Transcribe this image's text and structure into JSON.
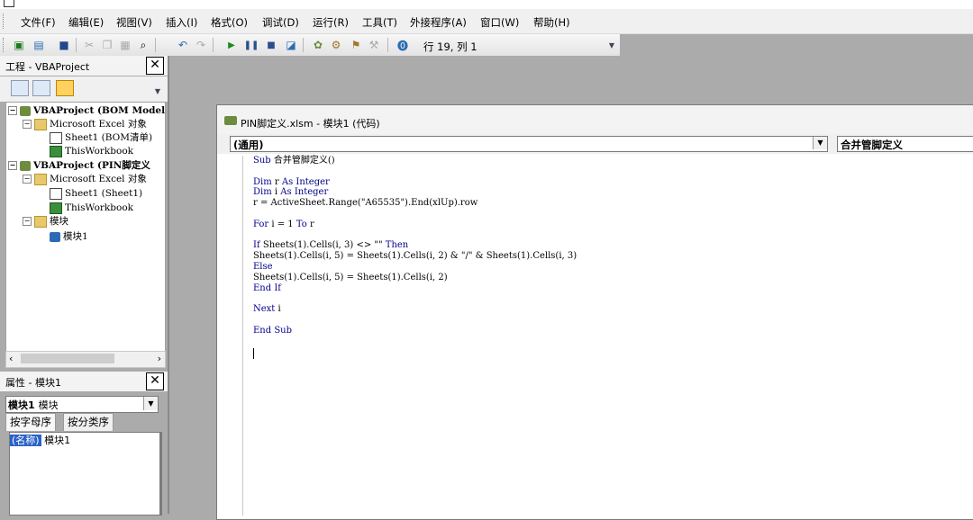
{
  "menubar": {
    "items": [
      "文件(F)",
      "编辑(E)",
      "视图(V)",
      "插入(I)",
      "格式(O)",
      "调试(D)",
      "运行(R)",
      "工具(T)",
      "外接程序(A)",
      "窗口(W)",
      "帮助(H)"
    ]
  },
  "toolbar": {
    "position_label": "行 19, 列 1"
  },
  "project_explorer": {
    "title": "工程 - VBAProject",
    "tree": [
      {
        "text": "VBAProject (BOM Model",
        "bold": true
      },
      {
        "text": "Microsoft Excel 对象"
      },
      {
        "text": "Sheet1 (BOM清单)"
      },
      {
        "text": "ThisWorkbook"
      },
      {
        "text": "VBAProject (PIN脚定义",
        "bold": true
      },
      {
        "text": "Microsoft Excel 对象"
      },
      {
        "text": "Sheet1 (Sheet1)"
      },
      {
        "text": "ThisWorkbook"
      },
      {
        "text": "模块"
      },
      {
        "text": "模块1"
      }
    ]
  },
  "properties": {
    "title": "属性 - 模块1",
    "object_name": "模块1",
    "object_type": "模块",
    "tabs": [
      "按字母序",
      "按分类序"
    ],
    "row_key": "(名称)",
    "row_value": "模块1"
  },
  "code_window": {
    "title": "PIN脚定义.xlsm - 模块1 (代码)",
    "object_combo": "(通用)",
    "procedure_combo": "合并管脚定义",
    "lines": [
      [
        {
          "t": "Sub ",
          "k": true
        },
        {
          "t": "合并管脚定义()"
        }
      ],
      [
        {
          "t": ""
        }
      ],
      [
        {
          "t": "Dim ",
          "k": true
        },
        {
          "t": "r "
        },
        {
          "t": "As Integer",
          "k": true
        }
      ],
      [
        {
          "t": "Dim ",
          "k": true
        },
        {
          "t": "i "
        },
        {
          "t": "As Integer",
          "k": true
        }
      ],
      [
        {
          "t": "r = ActiveSheet.Range(\"A65535\").End(xlUp).row"
        }
      ],
      [
        {
          "t": ""
        }
      ],
      [
        {
          "t": "For ",
          "k": true
        },
        {
          "t": "i = 1 "
        },
        {
          "t": "To ",
          "k": true
        },
        {
          "t": "r"
        }
      ],
      [
        {
          "t": ""
        }
      ],
      [
        {
          "t": "If ",
          "k": true
        },
        {
          "t": "Sheets(1).Cells(i, 3) <> \"\" "
        },
        {
          "t": "Then",
          "k": true
        }
      ],
      [
        {
          "t": "Sheets(1).Cells(i, 5) = Sheets(1).Cells(i, 2) & \"/\" & Sheets(1).Cells(i, 3)"
        }
      ],
      [
        {
          "t": "Else",
          "k": true
        }
      ],
      [
        {
          "t": "Sheets(1).Cells(i, 5) = Sheets(1).Cells(i, 2)"
        }
      ],
      [
        {
          "t": "End If",
          "k": true
        }
      ],
      [
        {
          "t": ""
        }
      ],
      [
        {
          "t": "Next ",
          "k": true
        },
        {
          "t": "i"
        }
      ],
      [
        {
          "t": ""
        }
      ],
      [
        {
          "t": "End Sub",
          "k": true
        }
      ]
    ]
  }
}
